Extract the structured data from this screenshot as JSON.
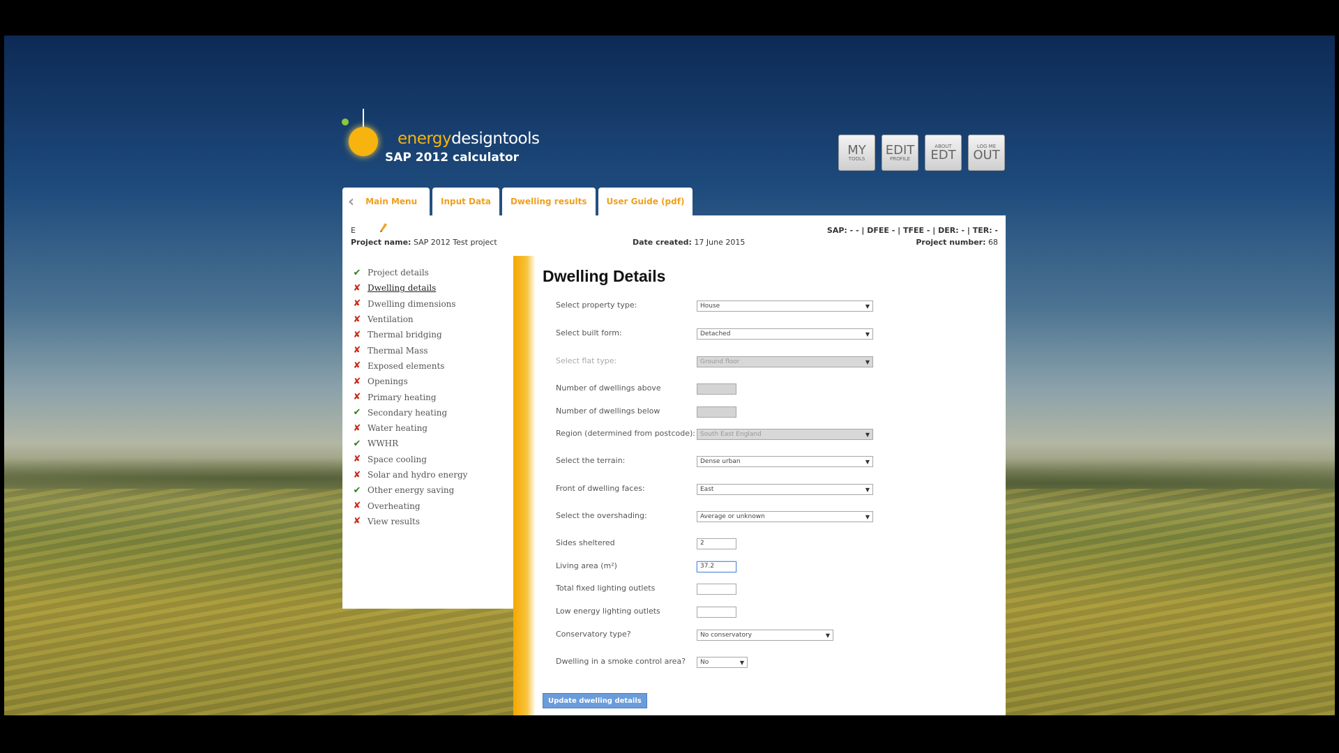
{
  "app": {
    "brand_energy": "energy",
    "brand_rest": "designtools",
    "subtitle": "SAP 2012 calculator"
  },
  "top_buttons": [
    {
      "big": "MY",
      "small": "TOOLS"
    },
    {
      "big": "EDIT",
      "small": "PROFILE"
    },
    {
      "small": "ABOUT",
      "big": "EDT"
    },
    {
      "small": "LOG ME",
      "big": "OUT"
    }
  ],
  "tabs": [
    "Main Menu",
    "Input Data",
    "Dwelling results",
    "User Guide (pdf)"
  ],
  "project": {
    "letter": "E",
    "name_label": "Project name:",
    "name": "SAP 2012 Test project",
    "date_label": "Date created:",
    "date": "17 June 2015",
    "results_line": "SAP: - - | DFEE - | TFEE - | DER: - | TER: -",
    "number_label": "Project number:",
    "number": "68"
  },
  "sidebar": [
    {
      "label": "Project details",
      "status": "ok"
    },
    {
      "label": "Dwelling details",
      "status": "x",
      "active": true
    },
    {
      "label": "Dwelling dimensions",
      "status": "x"
    },
    {
      "label": "Ventilation",
      "status": "x"
    },
    {
      "label": "Thermal bridging",
      "status": "x"
    },
    {
      "label": "Thermal Mass",
      "status": "x"
    },
    {
      "label": "Exposed elements",
      "status": "x"
    },
    {
      "label": "Openings",
      "status": "x"
    },
    {
      "label": "Primary heating",
      "status": "x"
    },
    {
      "label": "Secondary heating",
      "status": "ok"
    },
    {
      "label": "Water heating",
      "status": "x"
    },
    {
      "label": "WWHR",
      "status": "ok"
    },
    {
      "label": "Space cooling",
      "status": "x"
    },
    {
      "label": "Solar and hydro energy",
      "status": "x"
    },
    {
      "label": "Other energy saving",
      "status": "ok"
    },
    {
      "label": "Overheating",
      "status": "x"
    },
    {
      "label": "View results",
      "status": "x"
    }
  ],
  "form": {
    "title": "Dwelling Details",
    "property_type": {
      "label": "Select property type:",
      "value": "House"
    },
    "built_form": {
      "label": "Select built form:",
      "value": "Detached"
    },
    "flat_type": {
      "label": "Select flat type:",
      "value": "Ground floor"
    },
    "dwellings_above": {
      "label": "Number of dwellings above",
      "value": ""
    },
    "dwellings_below": {
      "label": "Number of dwellings below",
      "value": ""
    },
    "region": {
      "label": "Region (determined from postcode):",
      "value": "South East England"
    },
    "terrain": {
      "label": "Select the terrain:",
      "value": "Dense urban"
    },
    "front_faces": {
      "label": "Front of dwelling faces:",
      "value": "East"
    },
    "overshading": {
      "label": "Select the overshading:",
      "value": "Average or unknown"
    },
    "sides_sheltered": {
      "label": "Sides sheltered",
      "value": "2"
    },
    "living_area": {
      "label": "Living area (m²)",
      "value": "37.2"
    },
    "fixed_lighting": {
      "label": "Total fixed lighting outlets",
      "value": ""
    },
    "low_energy_lighting": {
      "label": "Low energy lighting outlets",
      "value": ""
    },
    "conservatory": {
      "label": "Conservatory type?",
      "value": "No conservatory"
    },
    "smoke_control": {
      "label": "Dwelling in a smoke control area?",
      "value": "No"
    },
    "submit_label": "Update dwelling details"
  },
  "colors": {
    "accent": "#f5a800",
    "tab_text": "#f0a020",
    "button": "#6a9cdb",
    "ok": "#2e7d1e",
    "x": "#cc2a1a"
  }
}
